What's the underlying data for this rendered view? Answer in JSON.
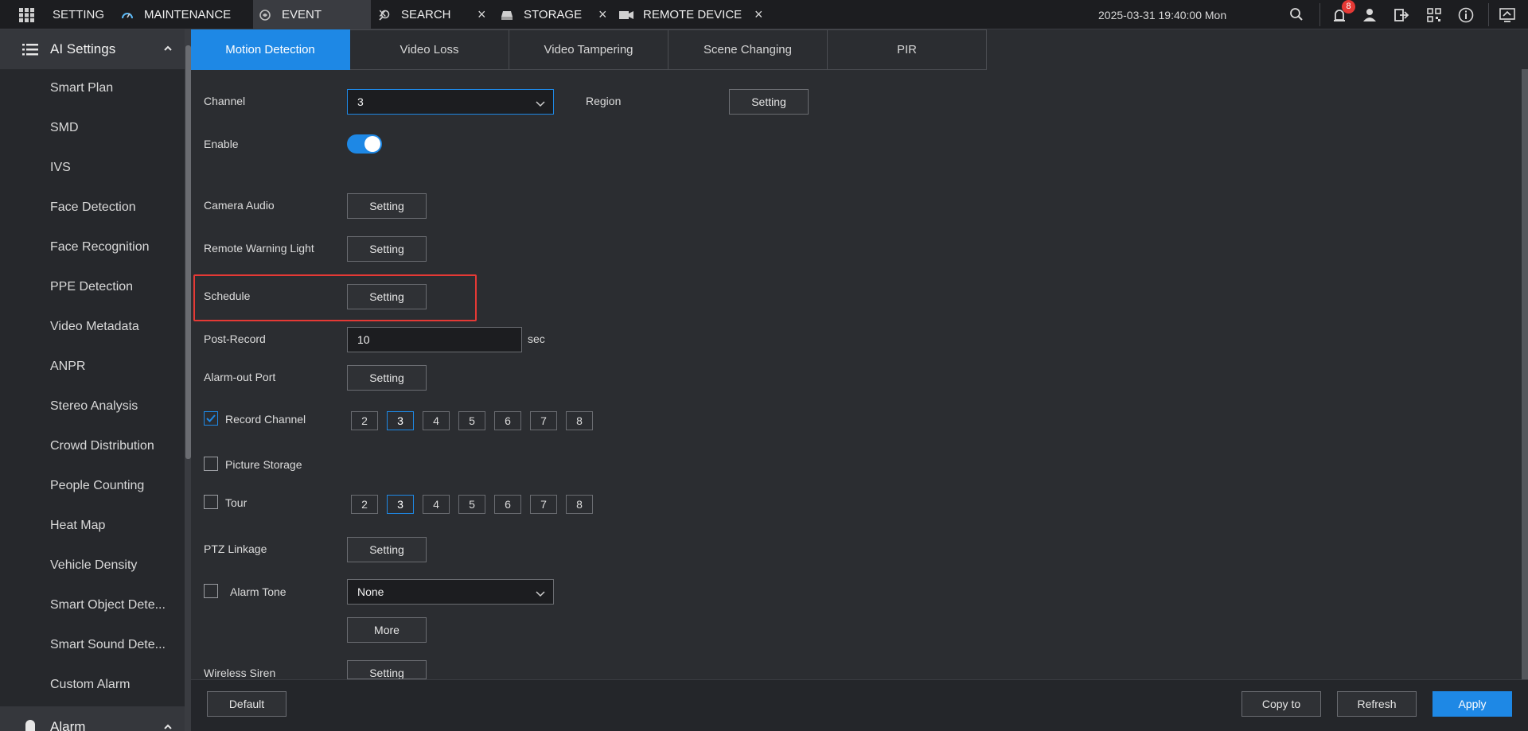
{
  "topbar": {
    "setting_label": "SETTING",
    "tabs": [
      {
        "label": "MAINTENANCE",
        "icon": "gauge-icon"
      },
      {
        "label": "EVENT",
        "icon": "event-icon",
        "active": true
      },
      {
        "label": "SEARCH",
        "icon": "search-icon"
      },
      {
        "label": "STORAGE",
        "icon": "storage-icon"
      },
      {
        "label": "REMOTE DEVICE",
        "icon": "camera-icon"
      }
    ],
    "close_glyph": "×",
    "datetime": "2025-03-31 19:40:00 Mon",
    "alarm_badge": "8"
  },
  "sidebar": {
    "group_ai": "AI Settings",
    "items": [
      "Smart Plan",
      "SMD",
      "IVS",
      "Face Detection",
      "Face Recognition",
      "PPE Detection",
      "Video Metadata",
      "ANPR",
      "Stereo Analysis",
      "Crowd Distribution",
      "People Counting",
      "Heat Map",
      "Vehicle Density",
      "Smart Object Dete...",
      "Smart Sound Dete...",
      "Custom Alarm"
    ],
    "group_alarm": "Alarm"
  },
  "subtabs": [
    "Motion Detection",
    "Video Loss",
    "Video Tampering",
    "Scene Changing",
    "PIR"
  ],
  "form": {
    "channel_label": "Channel",
    "channel_value": "3",
    "region_label": "Region",
    "enable_label": "Enable",
    "camera_audio_label": "Camera Audio",
    "remote_warning_light_label": "Remote Warning Light",
    "schedule_label": "Schedule",
    "post_record_label": "Post-Record",
    "post_record_value": "10",
    "post_record_unit": "sec",
    "alarm_out_label": "Alarm-out Port",
    "record_channel_label": "Record Channel",
    "picture_storage_label": "Picture Storage",
    "tour_label": "Tour",
    "ptz_label": "PTZ Linkage",
    "alarm_tone_label": "Alarm Tone",
    "alarm_tone_value": "None",
    "more_label": "More",
    "wireless_siren_label": "Wireless Siren",
    "setting_label": "Setting",
    "channels": [
      "2",
      "3",
      "4",
      "5",
      "6",
      "7",
      "8"
    ]
  },
  "footer": {
    "default": "Default",
    "copy_to": "Copy to",
    "refresh": "Refresh",
    "apply": "Apply"
  },
  "colors": {
    "accent": "#1e88e5",
    "highlight": "#e53935",
    "background": "#2b2d31"
  }
}
